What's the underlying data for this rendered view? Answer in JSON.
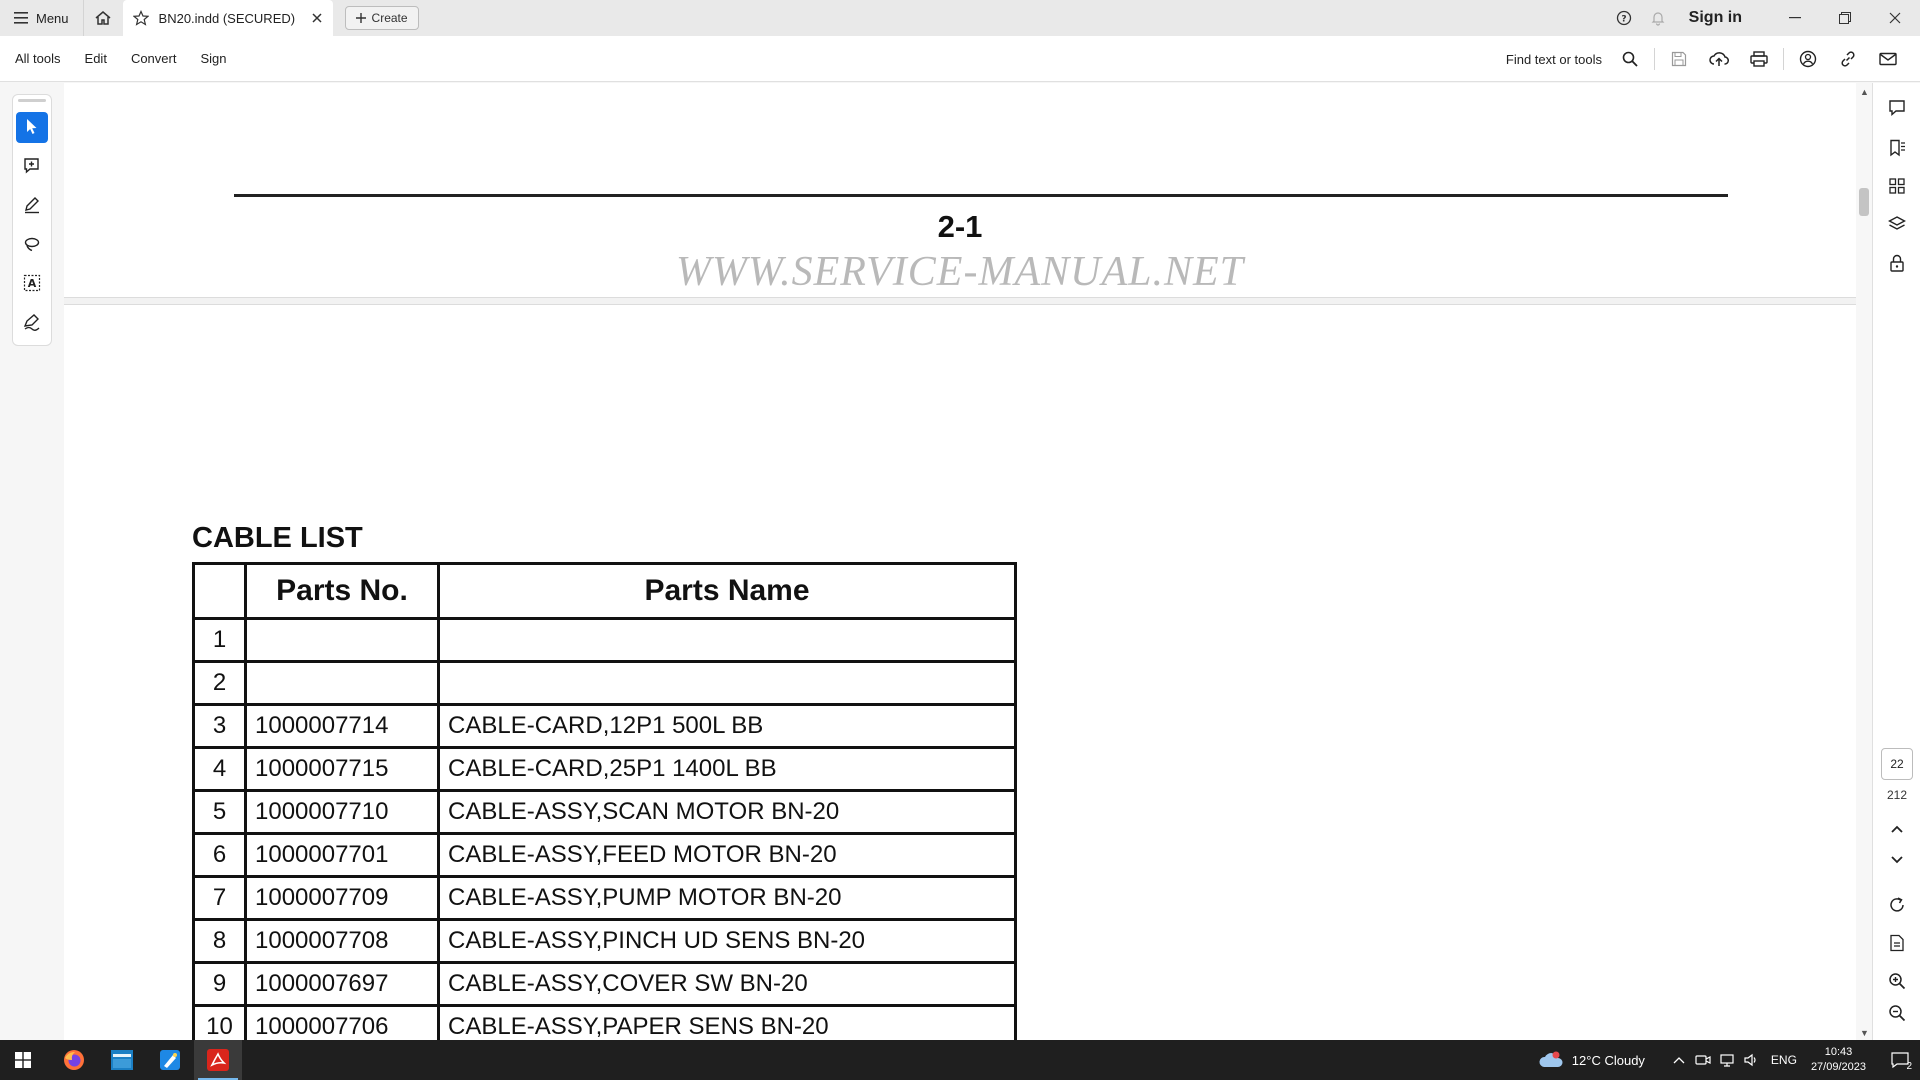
{
  "titlebar": {
    "menu_label": "Menu",
    "tab_title": "BN20.indd (SECURED)",
    "create_label": "Create",
    "sign_in_label": "Sign in"
  },
  "toolbar": {
    "menus": [
      "All tools",
      "Edit",
      "Convert",
      "Sign"
    ],
    "find_label": "Find text or tools"
  },
  "document": {
    "page_number": "2-1",
    "watermark": "WWW.SERVICE-MANUAL.NET",
    "section_title": "CABLE LIST",
    "table": {
      "headers": [
        "",
        "Parts No.",
        "Parts Name"
      ],
      "rows": [
        {
          "no": "1",
          "part": "",
          "name": ""
        },
        {
          "no": "2",
          "part": "",
          "name": ""
        },
        {
          "no": "3",
          "part": "1000007714",
          "name": "CABLE-CARD,12P1 500L BB"
        },
        {
          "no": "4",
          "part": "1000007715",
          "name": "CABLE-CARD,25P1 1400L BB"
        },
        {
          "no": "5",
          "part": "1000007710",
          "name": "CABLE-ASSY,SCAN MOTOR BN-20"
        },
        {
          "no": "6",
          "part": "1000007701",
          "name": "CABLE-ASSY,FEED MOTOR BN-20"
        },
        {
          "no": "7",
          "part": "1000007709",
          "name": "CABLE-ASSY,PUMP MOTOR BN-20"
        },
        {
          "no": "8",
          "part": "1000007708",
          "name": "CABLE-ASSY,PINCH UD SENS BN-20"
        },
        {
          "no": "9",
          "part": "1000007697",
          "name": "CABLE-ASSY,COVER SW BN-20"
        },
        {
          "no": "10",
          "part": "1000007706",
          "name": "CABLE-ASSY,PAPER SENS BN-20"
        }
      ]
    }
  },
  "navigation": {
    "current_page": "22",
    "total_pages": "212"
  },
  "taskbar": {
    "weather": "12°C  Cloudy",
    "language": "ENG",
    "time": "10:43",
    "date": "27/09/2023",
    "notification_count": "2"
  },
  "colors": {
    "accent": "#1473e6",
    "taskbar": "#1f1f1f"
  }
}
